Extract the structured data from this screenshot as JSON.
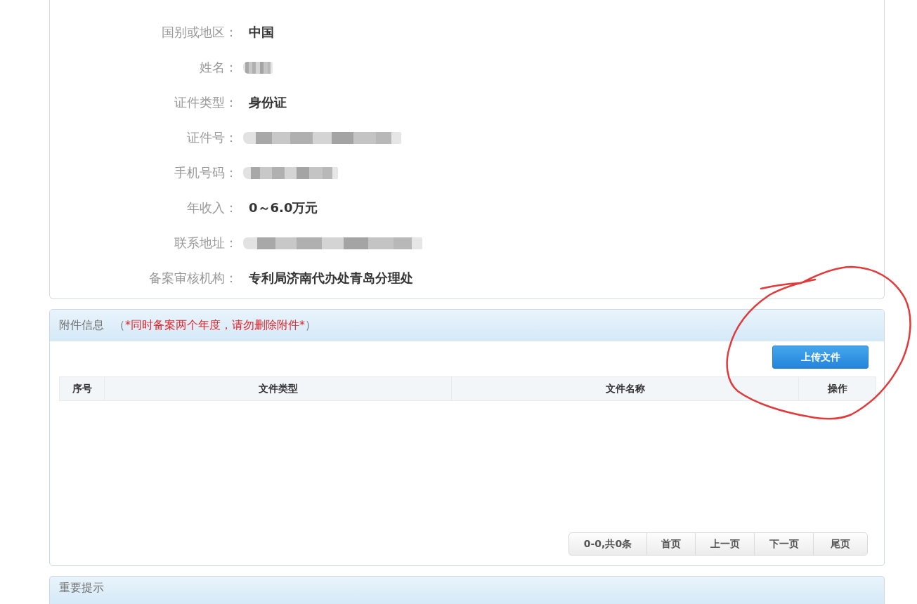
{
  "record": {
    "fields": [
      {
        "label": "国别或地区：",
        "kind": "text",
        "value": "中国"
      },
      {
        "label": "姓名：",
        "kind": "redacted"
      },
      {
        "label": "证件类型：",
        "kind": "text",
        "value": "身份证"
      },
      {
        "label": "证件号：",
        "kind": "redacted"
      },
      {
        "label": "手机号码：",
        "kind": "redacted"
      },
      {
        "label": "年收入：",
        "kind": "text",
        "value": "0～6.0万元"
      },
      {
        "label": "联系地址：",
        "kind": "redacted"
      },
      {
        "label": "备案审核机构：",
        "kind": "text",
        "value": "专利局济南代办处青岛分理处"
      }
    ]
  },
  "attachments": {
    "title": "附件信息",
    "note": "（*同时备案两个年度，请勿删除附件*）",
    "upload_button": "上传文件",
    "table": {
      "columns": [
        "序号",
        "文件类型",
        "文件名称",
        "操作"
      ]
    },
    "pager": {
      "summary": "0-0,共0条",
      "buttons": [
        "首页",
        "上一页",
        "下一页",
        "尾页"
      ]
    }
  },
  "notice": {
    "title": "重要提示"
  }
}
